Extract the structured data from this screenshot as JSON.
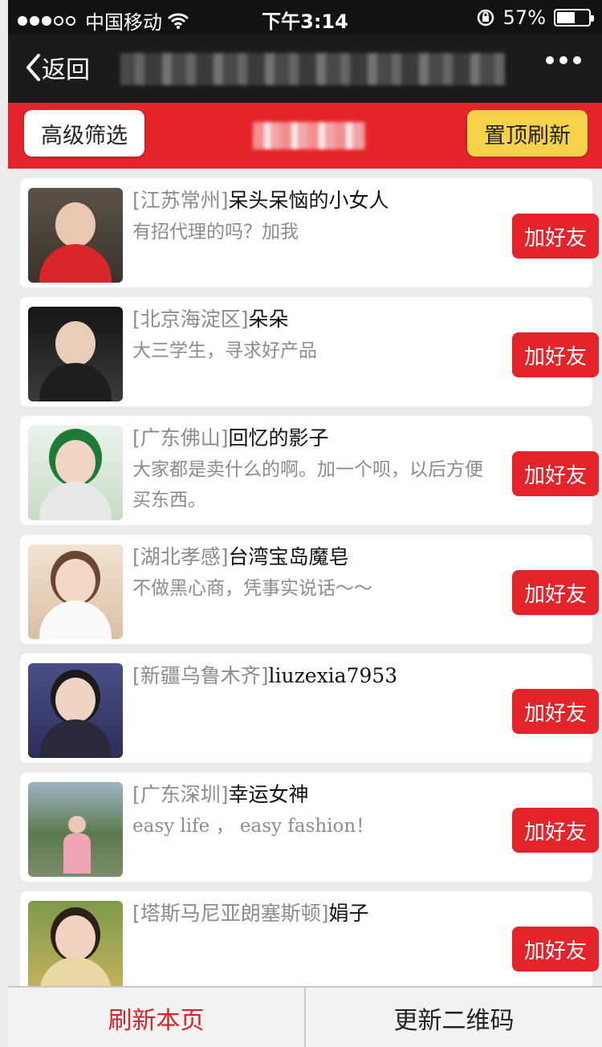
{
  "status_bar": {
    "carrier": "中国移动",
    "time": "下午3:14",
    "battery_percent": "57%",
    "battery_level": 0.57,
    "icons": [
      "signal-dots-icon",
      "wifi-icon",
      "rotation-lock-icon",
      "battery-icon"
    ]
  },
  "nav": {
    "back_label": "返回",
    "icons": [
      "chevron-left-icon",
      "more-dots-icon"
    ]
  },
  "filter_bar": {
    "advanced_filter_label": "高级筛选",
    "pin_refresh_label": "置顶刷新"
  },
  "list": {
    "add_label": "加好友",
    "items": [
      {
        "location": "[江苏常州]",
        "name": "呆头呆恼的小女人",
        "desc": "有招代理的吗？加我"
      },
      {
        "location": "[北京海淀区]",
        "name": "朵朵",
        "desc": "大三学生，寻求好产品"
      },
      {
        "location": "[广东佛山]",
        "name": "回忆的影子",
        "desc": "大家都是卖什么的啊。加一个呗，以后方便买东西。"
      },
      {
        "location": "[湖北孝感]",
        "name": "台湾宝岛魔皂",
        "desc": "不做黑心商，凭事实说话～～"
      },
      {
        "location": "[新疆乌鲁木齐]",
        "name": "liuzexia7953",
        "desc": ""
      },
      {
        "location": "[广东深圳]",
        "name": "幸运女神",
        "desc": "easy life ，  easy fashion！"
      },
      {
        "location": "[塔斯马尼亚朗塞斯顿]",
        "name": "娟子",
        "desc": ""
      }
    ]
  },
  "bottom_bar": {
    "refresh_label": "刷新本页",
    "update_qr_label": "更新二维码"
  },
  "colors": {
    "accent_red": "#e5232a",
    "button_yellow": "#f6d24a",
    "status_bar_bg": "#121212",
    "nav_bg": "#1b1b1b"
  }
}
